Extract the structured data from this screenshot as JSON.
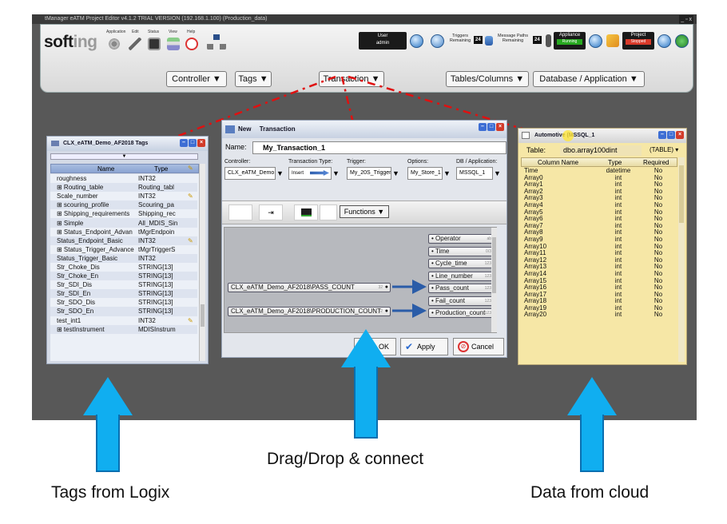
{
  "window": {
    "title": "tManager eATM Project Editor v4.1.2 TRIAL VERSION (192.168.1.100) (Production_data)",
    "controls": "_ ▫ x"
  },
  "toolbar": {
    "logo_main": "soft",
    "logo_tail": "ing",
    "icons": [
      {
        "label": "Application",
        "icon": "gear-icon"
      },
      {
        "label": "Edit",
        "icon": "pencil-icon"
      },
      {
        "label": "Status",
        "icon": "status-icon"
      },
      {
        "label": "View",
        "icon": "view-icon"
      },
      {
        "label": "Help",
        "icon": "help-icon"
      }
    ],
    "user_label": "User",
    "user_value": "admin",
    "triggers_label": "Triggers Remaining",
    "triggers_value": "24",
    "message_paths_label": "Message Paths Remaining",
    "message_paths_value": "24",
    "appliance_label": "Appliance",
    "appliance_status": "Running",
    "project_label": "Project",
    "project_status": "Stopped",
    "accent": "#1f6fc5",
    "running_color": "#27a820",
    "stopped_color": "#d83a2a"
  },
  "menu": {
    "controller": "Controller ▼",
    "tags": "Tags ▼",
    "transaction": "Transaction ▼",
    "tables_columns": "Tables/Columns ▼",
    "database_application": "Database / Application ▼"
  },
  "tags_panel": {
    "title": "CLX_eATM_Demo_AF2018 Tags",
    "col_name": "Name",
    "col_type": "Type",
    "rows": [
      {
        "name": "roughness",
        "type": "INT32"
      },
      {
        "name": "⊞ Routing_table",
        "type": "Routing_tabl"
      },
      {
        "name": "Scale_number",
        "type": "INT32"
      },
      {
        "name": "⊞ scouring_profile",
        "type": "Scouring_pa"
      },
      {
        "name": "⊞ Shipping_requirements",
        "type": "Shipping_rec"
      },
      {
        "name": "⊞ Simple",
        "type": "All_MDIS_Sin"
      },
      {
        "name": "⊞ Status_Endpoint_Advan",
        "type": "tMgrEndpoin"
      },
      {
        "name": "Status_Endpoint_Basic",
        "type": "INT32"
      },
      {
        "name": "⊞ Status_Trigger_Advance",
        "type": "tMgrTriggerS"
      },
      {
        "name": "Status_Trigger_Basic",
        "type": "INT32"
      },
      {
        "name": "Str_Choke_Dis",
        "type": "STRING[13]"
      },
      {
        "name": "Str_Choke_En",
        "type": "STRING[13]"
      },
      {
        "name": "Str_SDI_Dis",
        "type": "STRING[13]"
      },
      {
        "name": "Str_SDI_En",
        "type": "STRING[13]"
      },
      {
        "name": "Str_SDO_Dis",
        "type": "STRING[13]"
      },
      {
        "name": "Str_SDO_En",
        "type": "STRING[13]"
      },
      {
        "name": "test_int1",
        "type": "INT32"
      },
      {
        "name": "⊞ testInstrument",
        "type": "MDISInstrum"
      }
    ]
  },
  "transaction": {
    "title_new": "New",
    "title": "Transaction",
    "name_label": "Name:",
    "name_value": "My_Transaction_1",
    "controller_label": "Controller:",
    "controller_value": "CLX_eATM_Demo",
    "type_label": "Transaction Type:",
    "type_value": "Insert",
    "trigger_label": "Trigger:",
    "trigger_value": "My_20S_Trigger",
    "options_label": "Options:",
    "options_value": "My_Store_1",
    "db_label": "DB / Application:",
    "db_value": "MSSQL_1",
    "functions_label": "Functions ▼",
    "source_1": "CLX_eATM_Demo_AF2018\\PASS_COUNT",
    "source_1_size": "32",
    "source_2": "CLX_eATM_Demo_AF2018\\PRODUCTION_COUNT",
    "source_2_size": "32",
    "columns": [
      {
        "name": "Operator",
        "size": "ab"
      },
      {
        "name": "Time",
        "size": "0/3"
      },
      {
        "name": "Cycle_time",
        "size": "123"
      },
      {
        "name": "Line_number",
        "size": "123"
      },
      {
        "name": "Pass_count",
        "size": "123"
      },
      {
        "name": "Fail_count",
        "size": "123"
      },
      {
        "name": "Production_count",
        "size": "123"
      }
    ],
    "ok": "OK",
    "apply": "Apply",
    "cancel": "Cancel"
  },
  "table_panel": {
    "title": "Automotive (MSSQL_1",
    "table_label": "Table:",
    "table_value": "dbo.array100dint",
    "table_kind": "(TABLE) ▾",
    "col_name": "Column Name",
    "col_type": "Type",
    "col_required": "Required",
    "rows": [
      {
        "name": "Time",
        "type": "datetime",
        "required": "No"
      },
      {
        "name": "Array0",
        "type": "int",
        "required": "No"
      },
      {
        "name": "Array1",
        "type": "int",
        "required": "No"
      },
      {
        "name": "Array2",
        "type": "int",
        "required": "No"
      },
      {
        "name": "Array3",
        "type": "int",
        "required": "No"
      },
      {
        "name": "Array4",
        "type": "int",
        "required": "No"
      },
      {
        "name": "Array5",
        "type": "int",
        "required": "No"
      },
      {
        "name": "Array6",
        "type": "int",
        "required": "No"
      },
      {
        "name": "Array7",
        "type": "int",
        "required": "No"
      },
      {
        "name": "Array8",
        "type": "int",
        "required": "No"
      },
      {
        "name": "Array9",
        "type": "int",
        "required": "No"
      },
      {
        "name": "Array10",
        "type": "int",
        "required": "No"
      },
      {
        "name": "Array11",
        "type": "int",
        "required": "No"
      },
      {
        "name": "Array12",
        "type": "int",
        "required": "No"
      },
      {
        "name": "Array13",
        "type": "int",
        "required": "No"
      },
      {
        "name": "Array14",
        "type": "int",
        "required": "No"
      },
      {
        "name": "Array15",
        "type": "int",
        "required": "No"
      },
      {
        "name": "Array16",
        "type": "int",
        "required": "No"
      },
      {
        "name": "Array17",
        "type": "int",
        "required": "No"
      },
      {
        "name": "Array18",
        "type": "int",
        "required": "No"
      },
      {
        "name": "Array19",
        "type": "int",
        "required": "No"
      },
      {
        "name": "Array20",
        "type": "int",
        "required": "No"
      }
    ]
  },
  "captions": {
    "left": "Tags from Logix",
    "center": "Drag/Drop & connect",
    "right": "Data from cloud"
  },
  "colors": {
    "arrow": "#10aef0",
    "dash": "#e01010",
    "cloud_panel": "#f6e7a6",
    "panel_bg": "#d4dae6"
  }
}
